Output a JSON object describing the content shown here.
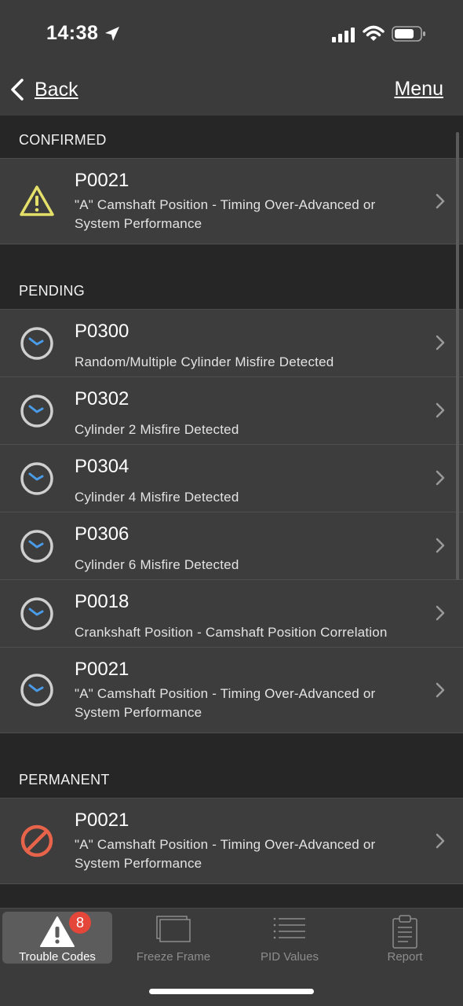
{
  "status_bar": {
    "time": "14:38"
  },
  "nav": {
    "back_label": "Back",
    "menu_label": "Menu"
  },
  "sections": [
    {
      "title": "CONFIRMED",
      "items": [
        {
          "code": "P0021",
          "description": "\"A\" Camshaft Position - Timing Over-Advanced or System Performance",
          "icon": "warning-icon"
        }
      ]
    },
    {
      "title": "PENDING",
      "items": [
        {
          "code": "P0300",
          "description": "Random/Multiple Cylinder Misfire Detected",
          "icon": "clock-icon"
        },
        {
          "code": "P0302",
          "description": "Cylinder 2 Misfire Detected",
          "icon": "clock-icon"
        },
        {
          "code": "P0304",
          "description": "Cylinder 4 Misfire Detected",
          "icon": "clock-icon"
        },
        {
          "code": "P0306",
          "description": "Cylinder 6 Misfire Detected",
          "icon": "clock-icon"
        },
        {
          "code": "P0018",
          "description": "Crankshaft Position - Camshaft Position Correlation",
          "icon": "clock-icon"
        },
        {
          "code": "P0021",
          "description": "\"A\" Camshaft Position - Timing Over-Advanced or System Performance",
          "icon": "clock-icon"
        }
      ]
    },
    {
      "title": "PERMANENT",
      "items": [
        {
          "code": "P0021",
          "description": "\"A\" Camshaft Position - Timing Over-Advanced or System Performance",
          "icon": "prohibited-icon"
        }
      ]
    }
  ],
  "tabs": [
    {
      "label": "Trouble Codes",
      "badge": "8",
      "active": true
    },
    {
      "label": "Freeze Frame"
    },
    {
      "label": "PID Values"
    },
    {
      "label": "Report"
    }
  ],
  "colors": {
    "warning": "#e4e06a",
    "clock_hand": "#4a9be8",
    "prohibited": "#e7634a",
    "badge": "#e5463a"
  }
}
